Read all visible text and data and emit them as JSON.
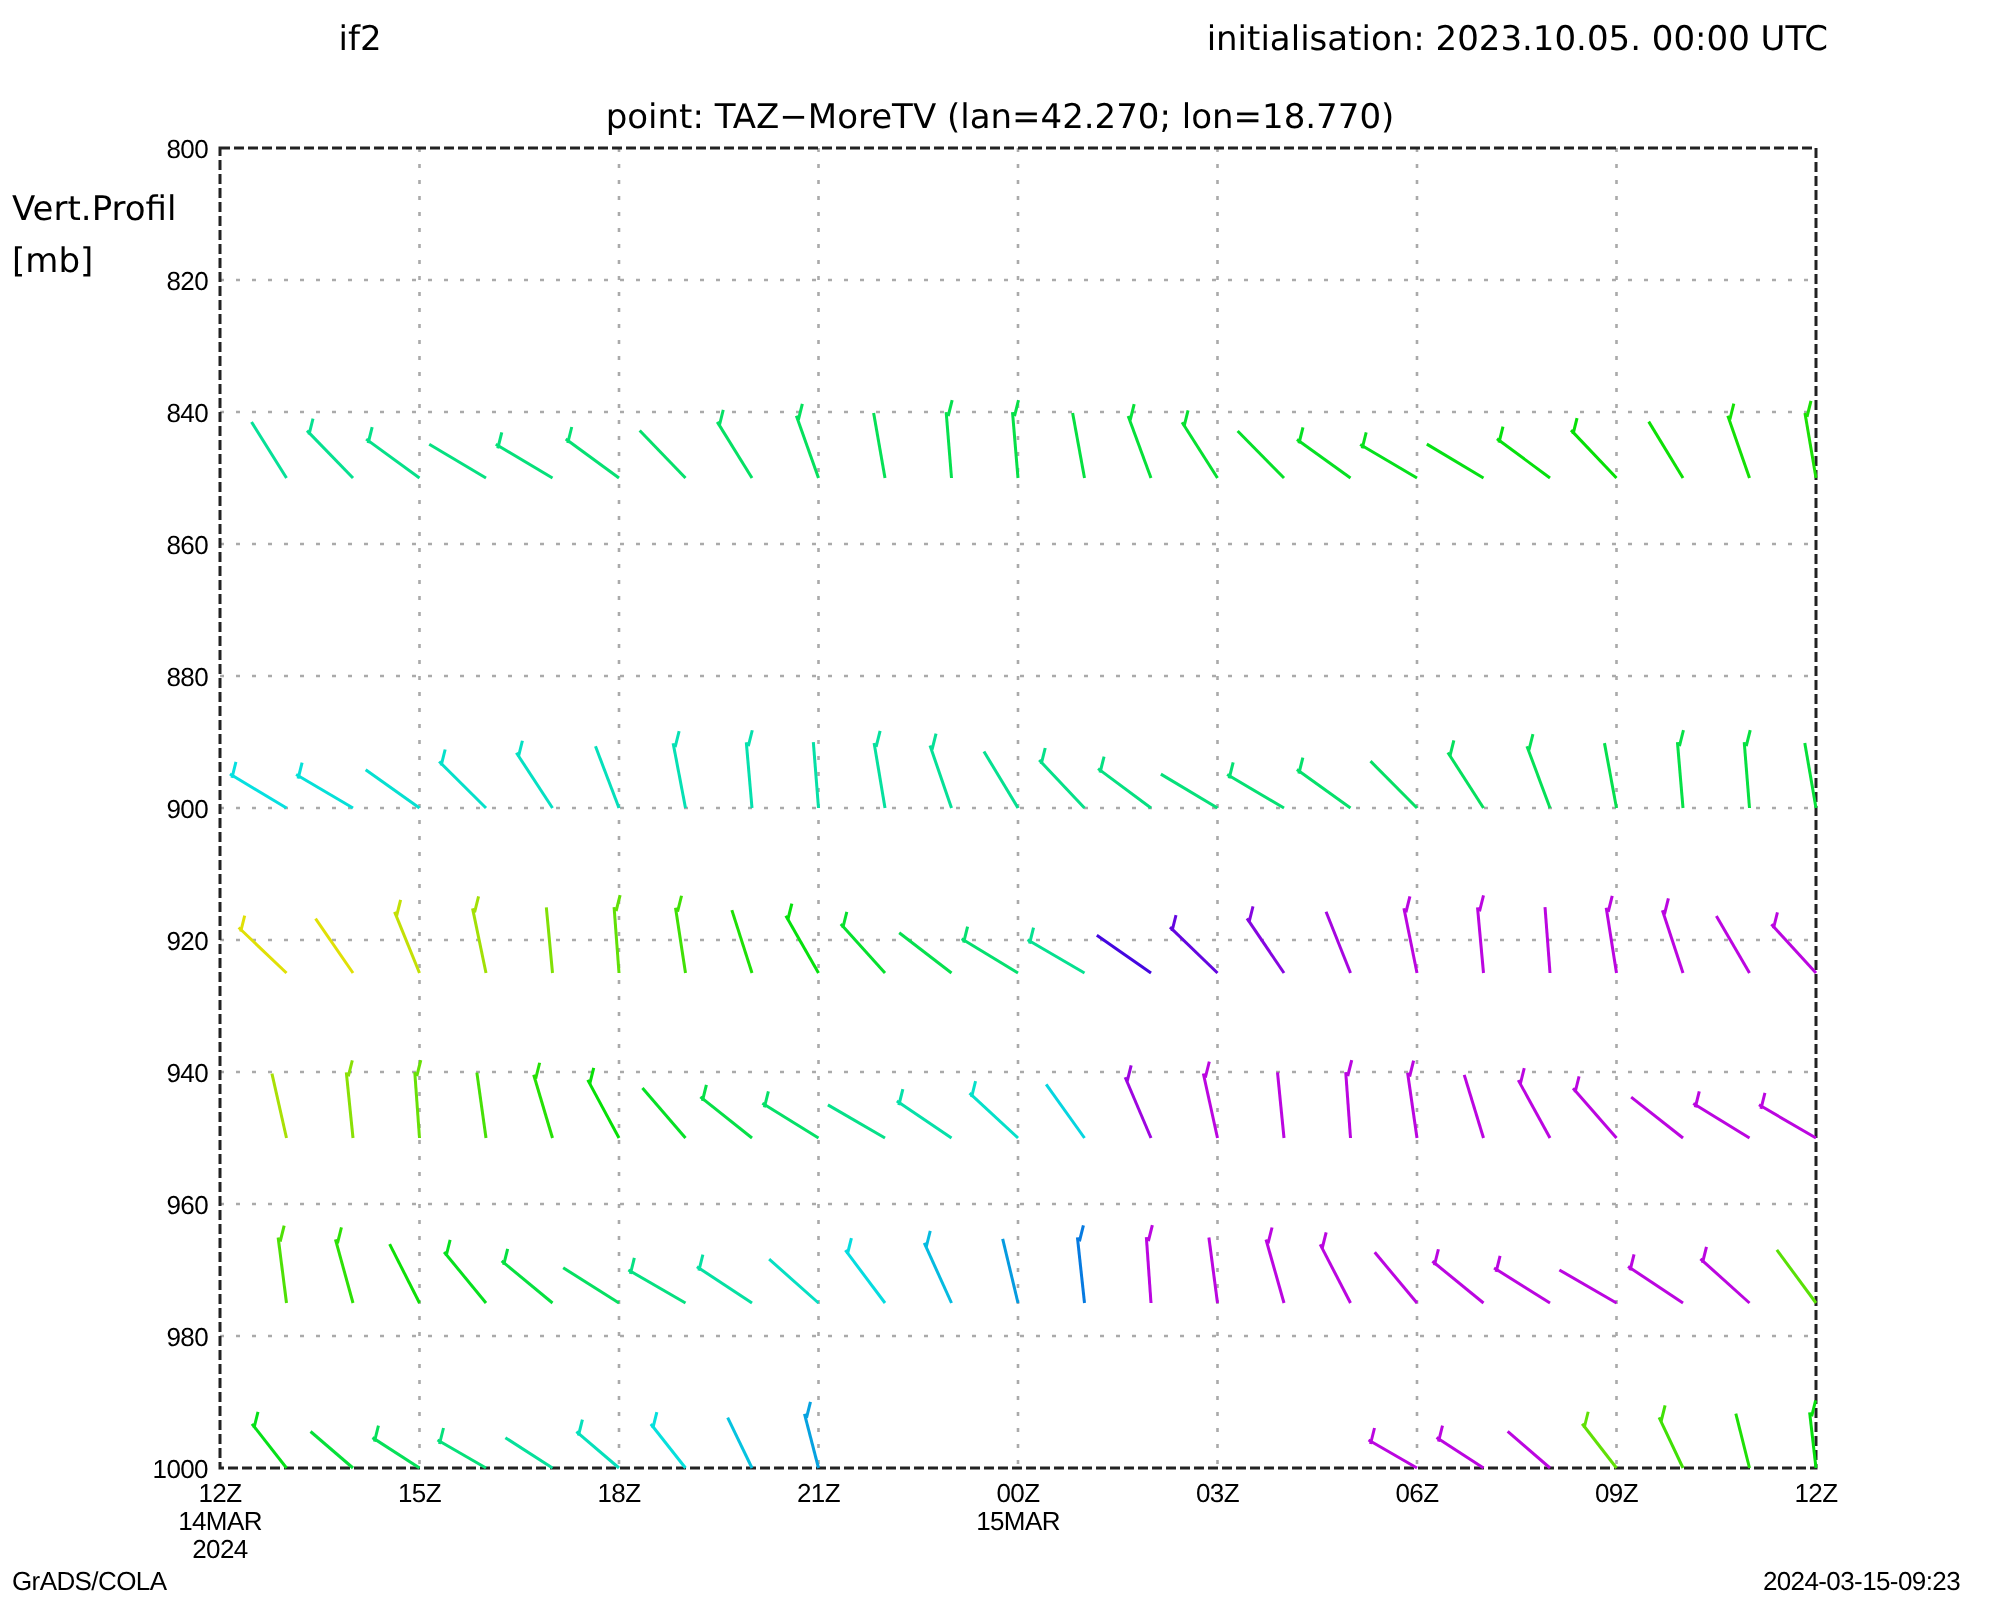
{
  "header": {
    "left": "if2",
    "right": "initialisation: 2023.10.05. 00:00 UTC"
  },
  "plot": {
    "subtitle": "point: TAZ−MoreTV (lan=42.270; lon=18.770)",
    "ylabel": [
      "Vert.Profil",
      "[mb]"
    ],
    "yticks": [
      "800",
      "820",
      "840",
      "860",
      "880",
      "900",
      "920",
      "940",
      "960",
      "980",
      "1000"
    ],
    "xticks": [
      {
        "label": "12Z",
        "sub": [
          "14MAR",
          "2024"
        ]
      },
      {
        "label": "15Z"
      },
      {
        "label": "18Z"
      },
      {
        "label": "21Z"
      },
      {
        "label": "00Z",
        "sub": [
          "15MAR"
        ]
      },
      {
        "label": "03Z"
      },
      {
        "label": "06Z"
      },
      {
        "label": "09Z"
      },
      {
        "label": "12Z"
      }
    ]
  },
  "footer": {
    "left": "GrADS/COLA",
    "right": "2024-03-15-09:23"
  }
}
